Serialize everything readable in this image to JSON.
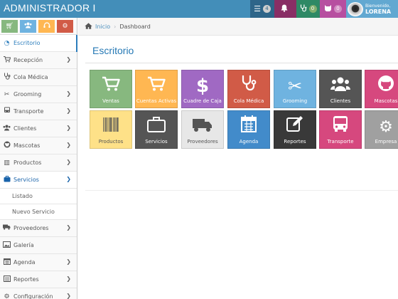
{
  "topbar": {
    "brand": "ADMINISTRADOR I",
    "tasks_count": "4",
    "messages_count": "0",
    "pets_count": "0",
    "user_greeting": "Bienvenido,",
    "user_name": "LORENA"
  },
  "breadcrumb": {
    "home": "Inicio",
    "current": "Dashboard"
  },
  "page": {
    "title": "Escritorio"
  },
  "sidebar": {
    "items": [
      {
        "label": "Escritorio"
      },
      {
        "label": "Recepción"
      },
      {
        "label": "Cola Médica"
      },
      {
        "label": "Grooming"
      },
      {
        "label": "Transporte"
      },
      {
        "label": "Clientes"
      },
      {
        "label": "Mascotas"
      },
      {
        "label": "Productos"
      },
      {
        "label": "Servicios"
      },
      {
        "label": "Proveedores"
      },
      {
        "label": "Galería"
      },
      {
        "label": "Agenda"
      },
      {
        "label": "Reportes"
      },
      {
        "label": "Configuración"
      }
    ],
    "subitems": [
      {
        "label": "Listado"
      },
      {
        "label": "Nuevo Servicio"
      }
    ]
  },
  "tiles": [
    {
      "label": "Ventas",
      "color": "#87b87f",
      "icon": "cart-icon"
    },
    {
      "label": "Cuentas Activas",
      "color": "#ffb752",
      "icon": "cart-icon"
    },
    {
      "label": "Cuadre de Caja",
      "color": "#a069c3",
      "icon": "dollar-icon"
    },
    {
      "label": "Cola Médica",
      "color": "#d15b47",
      "icon": "stethoscope-icon"
    },
    {
      "label": "Grooming",
      "color": "#6fb3e0",
      "icon": "scissors-icon"
    },
    {
      "label": "Clientes",
      "color": "#555555",
      "icon": "users-icon"
    },
    {
      "label": "Mascotas",
      "color": "#d6487e",
      "icon": "github-cat-icon"
    },
    {
      "label": "Productos",
      "color": "#fee188",
      "icon": "barcode-icon"
    },
    {
      "label": "Servicios",
      "color": "#555555",
      "icon": "briefcase-icon"
    },
    {
      "label": "Proveedores",
      "color": "#e7e7e7",
      "icon": "truck-icon"
    },
    {
      "label": "Agenda",
      "color": "#428bca",
      "icon": "calendar-icon"
    },
    {
      "label": "Reportes",
      "color": "#393939",
      "icon": "edit-icon"
    },
    {
      "label": "Transporte",
      "color": "#d6487e",
      "icon": "bus-icon"
    },
    {
      "label": "Empresa",
      "color": "#a0a0a0",
      "icon": "cogs-icon"
    }
  ]
}
